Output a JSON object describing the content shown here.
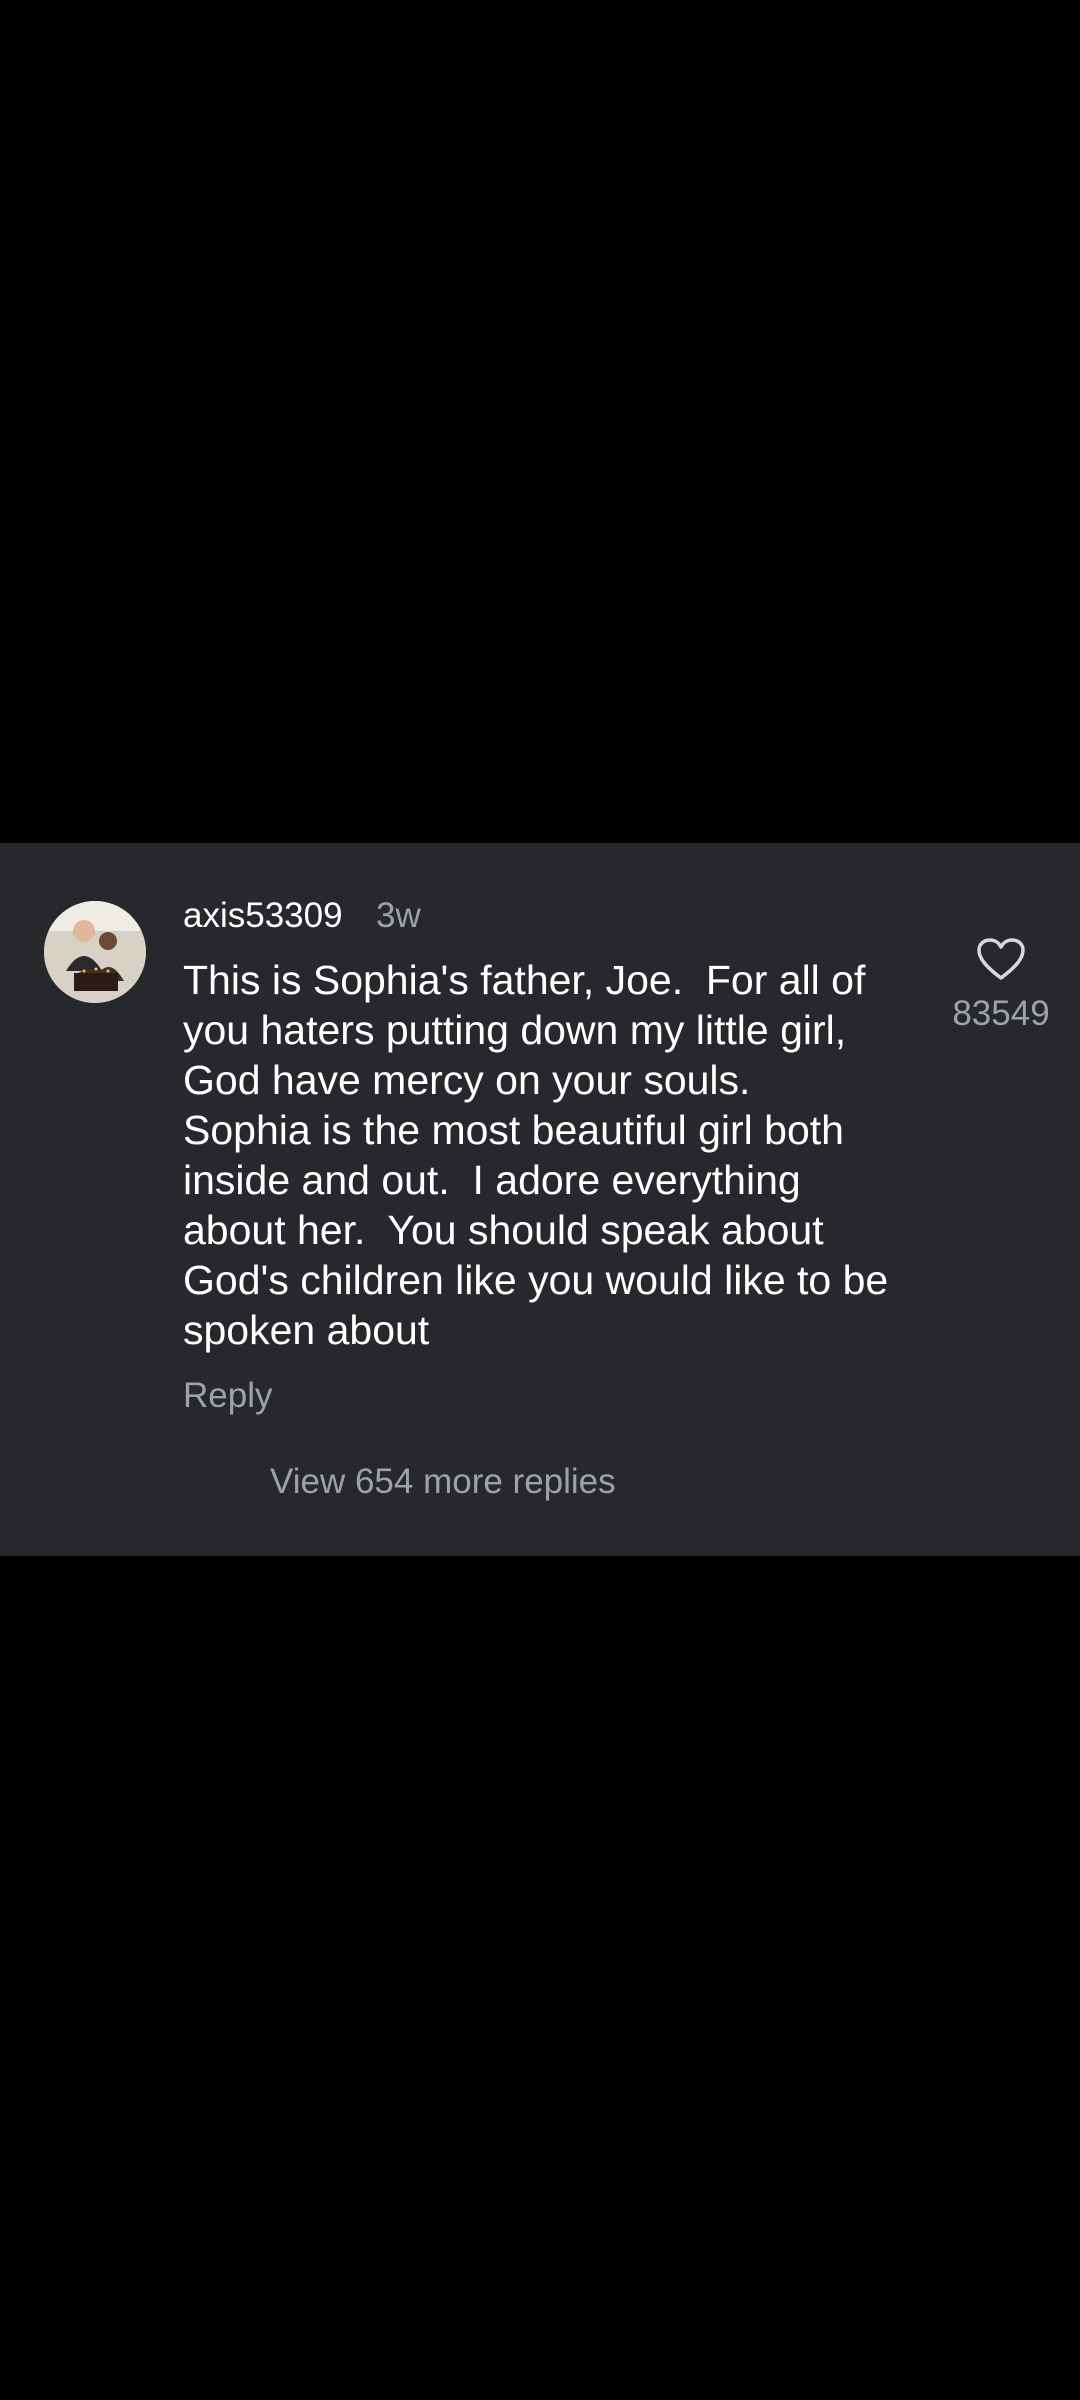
{
  "comment": {
    "username": "axis53309",
    "timestamp": "3w",
    "text": "This is Sophia's father, Joe.  For all of\nyou haters putting down my little girl,\nGod have mercy on your souls.\nSophia is the most beautiful girl both\ninside and out.  I adore everything\nabout her.  You should speak about\nGod's children like you would like to be\nspoken about",
    "reply_label": "Reply",
    "view_replies_label": "View 654 more replies",
    "like_count": "83549"
  },
  "icons": {
    "avatar": "profile-photo",
    "like": "heart-outline-icon"
  },
  "colors": {
    "background": "#000000",
    "card": "#26282c",
    "primary_text": "#ffffff",
    "secondary_text": "#9ea2a8"
  }
}
